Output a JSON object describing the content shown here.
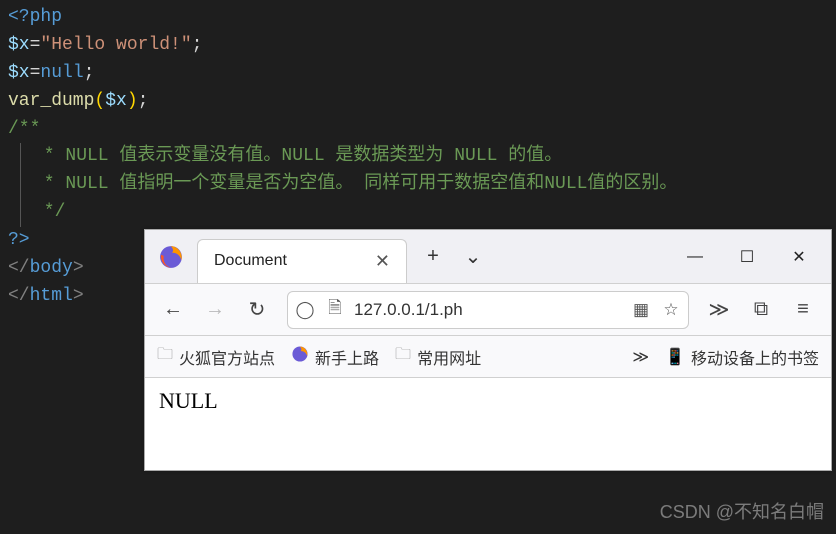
{
  "code": {
    "php_open": "<?php",
    "line2_var": "$x",
    "line2_eq": "=",
    "line2_str": "\"Hello world!\"",
    "line2_semi": ";",
    "line3_var": "$x",
    "line3_eq": "=",
    "line3_null": "null",
    "line3_semi": ";",
    "line4_func": "var_dump",
    "line4_lp": "(",
    "line4_arg": "$x",
    "line4_rp": ")",
    "line4_semi": ";",
    "comment_open": "/**",
    "comment_line1": " * NULL 值表示变量没有值。NULL 是数据类型为 NULL 的值。",
    "comment_line2": " * NULL 值指明一个变量是否为空值。 同样可用于数据空值和NULL值的区别。",
    "comment_close": " */",
    "php_close": "?>",
    "body_close_open": "</",
    "body_close_name": "body",
    "body_close_end": ">",
    "html_close_open": "</",
    "html_close_name": "html",
    "html_close_end": ">"
  },
  "browser": {
    "tab_title": "Document",
    "new_tab": "+",
    "chevron": "⌄",
    "min": "—",
    "max": "☐",
    "close": "✕",
    "back": "←",
    "forward": "→",
    "reload": "↻",
    "shield": "◯",
    "doc_icon": "🗎",
    "url": "127.0.0.1/1.ph",
    "qr": "▦",
    "star": "☆",
    "overflow": "≫",
    "ext": "⧉",
    "menu": "≡",
    "bookmarks": {
      "b1": "火狐官方站点",
      "b2": "新手上路",
      "b3": "常用网址",
      "overflow": "≫",
      "mobile_icon": "📱",
      "mobile": "移动设备上的书签"
    },
    "content": "NULL"
  },
  "watermark": "CSDN @不知名白帽"
}
